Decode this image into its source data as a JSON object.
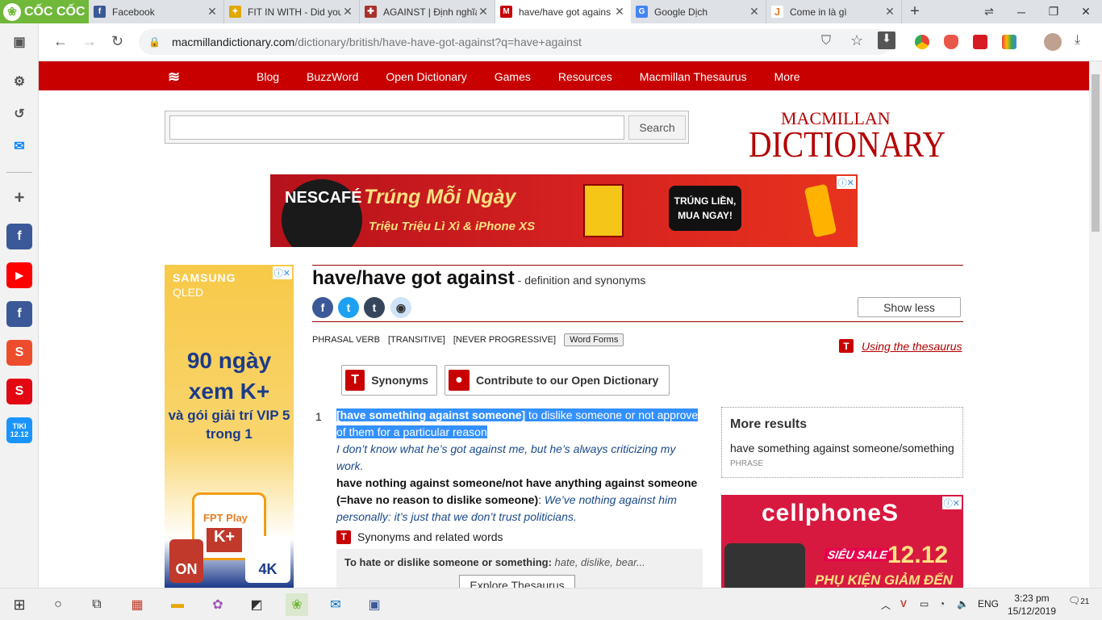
{
  "browser": {
    "brand": "CỐC CỐC",
    "tabs": [
      {
        "title": "Facebook",
        "icon": "facebook-icon",
        "active": false
      },
      {
        "title": "FIT IN WITH - Did you",
        "icon": "puzzle-icon",
        "active": false
      },
      {
        "title": "AGAINST | Định nghĩa",
        "icon": "cambridge-icon",
        "active": false
      },
      {
        "title": "have/have got agains",
        "icon": "macmillan-icon",
        "active": true
      },
      {
        "title": "Google Dịch",
        "icon": "google-translate-icon",
        "active": false
      },
      {
        "title": "Come in là gì",
        "icon": "j-icon",
        "active": false
      }
    ],
    "url_host": "macmillandictionary.com",
    "url_path": "/dictionary/british/have-have-got-against?q=have+against"
  },
  "site": {
    "nav": [
      "Blog",
      "BuzzWord",
      "Open Dictionary",
      "Games",
      "Resources",
      "Macmillan Thesaurus",
      "More"
    ],
    "search_button": "Search",
    "search_value": "",
    "logo_top": "MACMILLAN",
    "logo_bottom": "DICTIONARY"
  },
  "ad_top": {
    "brand": "NESCAFÉ",
    "headline": "Trúng Mỗi Ngày",
    "sub": "Triệu Triệu Lì Xì & iPhone XS",
    "cta": "TRÚNG LIỀN, MUA NGAY!"
  },
  "ad_left": {
    "brand": "SAMSUNG",
    "sub": "QLED",
    "headline": "90 ngày xem K+",
    "sub2": "và gói giải trí VIP 5 trong 1",
    "fpt": "FPT Play",
    "kplus": "K+",
    "on": "ON",
    "fim": "4K"
  },
  "entry": {
    "headword": "have/have got against",
    "subtitle": " - definition and synonyms",
    "show_less": "Show less",
    "grammar": [
      "PHRASAL VERB",
      "[TRANSITIVE]",
      "[NEVER PROGRESSIVE]"
    ],
    "word_forms": "Word Forms",
    "thesaurus_link": "Using the thesaurus",
    "synonyms_btn": "Synonyms",
    "contribute_btn": "Contribute to our Open Dictionary",
    "sense_number": "1",
    "pattern": "[have something against someone]",
    "definition": " to dislike someone or not approve of them for a particular reason",
    "example1": "I don’t know what he’s got against me, but he’s always criticizing my work.",
    "phrase": "have nothing against someone/not have anything against someone (=have no reason to dislike someone)",
    "phrase_sep": ": ",
    "example2": "We’ve nothing against him personally: it’s just that we don’t trust politicians.",
    "syn_heading": "Synonyms and related words",
    "syn_key": "To hate or dislike someone or something:",
    "syn_values": " hate, dislike, bear...",
    "explore": "Explore Thesaurus"
  },
  "more_results": {
    "heading": "More results",
    "result": "have something against someone/something",
    "pos": "PHRASE"
  },
  "ad_right": {
    "brand": "cellphoneS",
    "sale": "SIÊU SALE",
    "date": "12.12",
    "promo": "PHỤ KIỆN GIẢM ĐẾN"
  },
  "taskbar": {
    "lang": "ENG",
    "time": "3:23 pm",
    "date": "15/12/2019",
    "notifications": "21"
  }
}
